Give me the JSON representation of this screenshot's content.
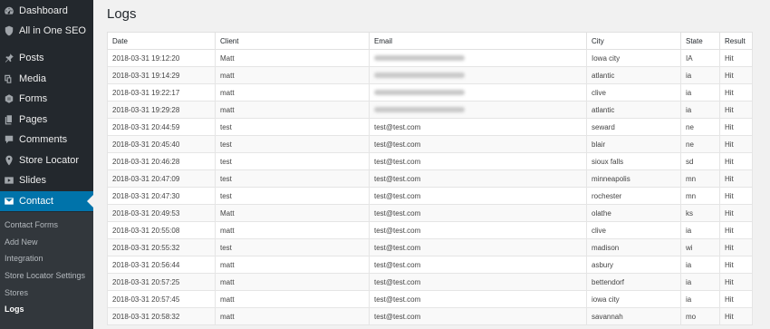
{
  "sidebar": {
    "items": [
      {
        "label": "Dashboard",
        "icon": "dashboard-icon"
      },
      {
        "label": "All in One SEO",
        "icon": "shield-icon"
      },
      {
        "label": "Posts",
        "icon": "pin-icon"
      },
      {
        "label": "Media",
        "icon": "media-icon"
      },
      {
        "label": "Forms",
        "icon": "forms-icon"
      },
      {
        "label": "Pages",
        "icon": "pages-icon"
      },
      {
        "label": "Comments",
        "icon": "comments-icon"
      },
      {
        "label": "Store Locator",
        "icon": "location-icon"
      },
      {
        "label": "Slides",
        "icon": "slides-icon"
      },
      {
        "label": "Contact",
        "icon": "envelope-icon"
      }
    ],
    "submenu": [
      "Contact Forms",
      "Add New",
      "Integration",
      "Store Locator Settings",
      "Stores",
      "Logs"
    ],
    "active_color": "#0073aa"
  },
  "page": {
    "title": "Logs"
  },
  "table": {
    "columns": [
      "Date",
      "Client",
      "Email",
      "City",
      "State",
      "Result"
    ],
    "rows": [
      {
        "date": "2018-03-31 19:12:20",
        "client": "Matt",
        "email": "",
        "city": "Iowa city",
        "state": "IA",
        "result": "Hit"
      },
      {
        "date": "2018-03-31 19:14:29",
        "client": "matt",
        "email": "",
        "city": "atlantic",
        "state": "ia",
        "result": "Hit"
      },
      {
        "date": "2018-03-31 19:22:17",
        "client": "matt",
        "email": "",
        "city": "clive",
        "state": "ia",
        "result": "Hit"
      },
      {
        "date": "2018-03-31 19:29:28",
        "client": "matt",
        "email": "",
        "city": "atlantic",
        "state": "ia",
        "result": "Hit"
      },
      {
        "date": "2018-03-31 20:44:59",
        "client": "test",
        "email": "test@test.com",
        "city": "seward",
        "state": "ne",
        "result": "Hit"
      },
      {
        "date": "2018-03-31 20:45:40",
        "client": "test",
        "email": "test@test.com",
        "city": "blair",
        "state": "ne",
        "result": "Hit"
      },
      {
        "date": "2018-03-31 20:46:28",
        "client": "test",
        "email": "test@test.com",
        "city": "sioux falls",
        "state": "sd",
        "result": "Hit"
      },
      {
        "date": "2018-03-31 20:47:09",
        "client": "test",
        "email": "test@test.com",
        "city": "minneapolis",
        "state": "mn",
        "result": "Hit"
      },
      {
        "date": "2018-03-31 20:47:30",
        "client": "test",
        "email": "test@test.com",
        "city": "rochester",
        "state": "mn",
        "result": "Hit"
      },
      {
        "date": "2018-03-31 20:49:53",
        "client": "Matt",
        "email": "test@test.com",
        "city": "olathe",
        "state": "ks",
        "result": "Hit"
      },
      {
        "date": "2018-03-31 20:55:08",
        "client": "matt",
        "email": "test@test.com",
        "city": "clive",
        "state": "ia",
        "result": "Hit"
      },
      {
        "date": "2018-03-31 20:55:32",
        "client": "test",
        "email": "test@test.com",
        "city": "madison",
        "state": "wi",
        "result": "Hit"
      },
      {
        "date": "2018-03-31 20:56:44",
        "client": "matt",
        "email": "test@test.com",
        "city": "asbury",
        "state": "ia",
        "result": "Hit"
      },
      {
        "date": "2018-03-31 20:57:25",
        "client": "matt",
        "email": "test@test.com",
        "city": "bettendorf",
        "state": "ia",
        "result": "Hit"
      },
      {
        "date": "2018-03-31 20:57:45",
        "client": "matt",
        "email": "test@test.com",
        "city": "iowa city",
        "state": "ia",
        "result": "Hit"
      },
      {
        "date": "2018-03-31 20:58:32",
        "client": "matt",
        "email": "test@test.com",
        "city": "savannah",
        "state": "mo",
        "result": "Hit"
      }
    ]
  }
}
